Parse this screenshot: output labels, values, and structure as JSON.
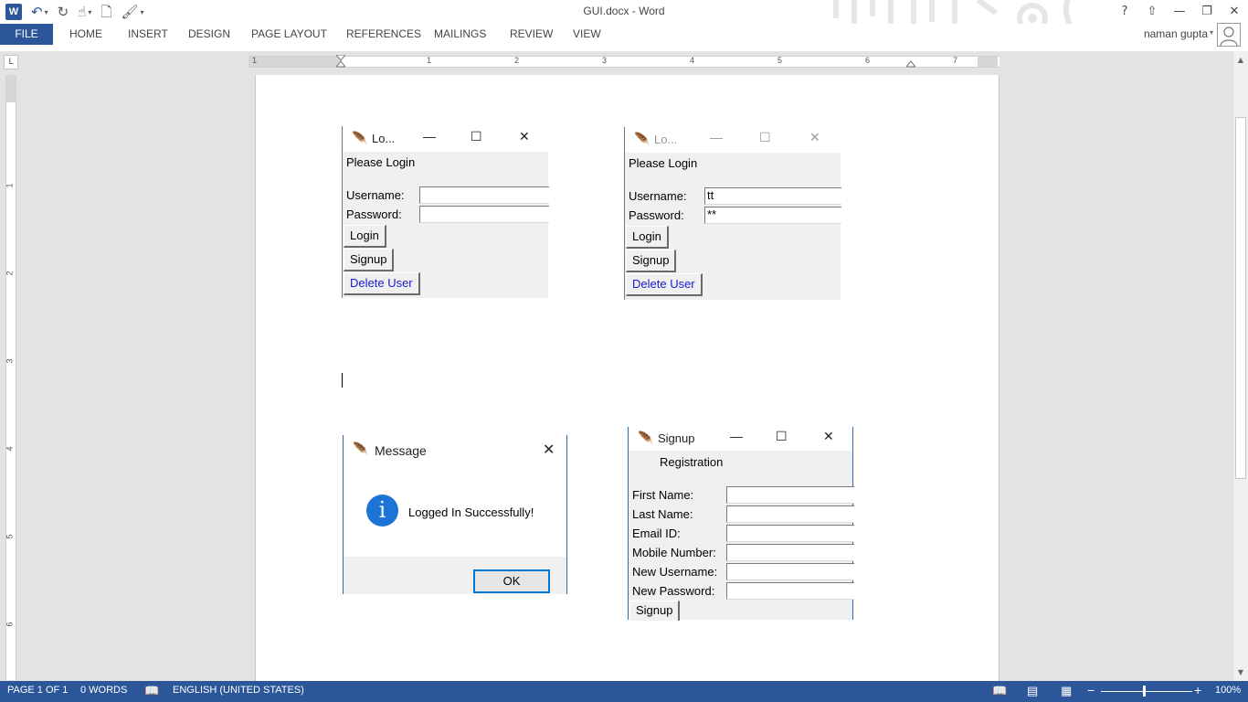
{
  "app": {
    "doc_title": "GUI.docx - Word",
    "user_name": "naman gupta"
  },
  "qat": {
    "logo": "W",
    "icons": [
      "word-logo",
      "undo-icon",
      "redo-icon",
      "touch-mode-icon",
      "new-document-icon",
      "format-painter-icon",
      "customize-icon"
    ]
  },
  "window_controls": [
    "?",
    "⇧",
    "—",
    "❐",
    "✕"
  ],
  "ribbon": {
    "tabs": [
      "FILE",
      "HOME",
      "INSERT",
      "DESIGN",
      "PAGE LAYOUT",
      "REFERENCES",
      "MAILINGS",
      "REVIEW",
      "VIEW"
    ]
  },
  "ruler": {
    "h_numbers": [
      "1",
      "1",
      "2",
      "3",
      "4",
      "5",
      "6",
      "7"
    ],
    "v_numbers": [
      "1",
      "2",
      "3",
      "4",
      "5",
      "6"
    ],
    "corner": "L"
  },
  "login1": {
    "title": "Lo...",
    "heading": "Please Login",
    "username_label": "Username:",
    "password_label": "Password:",
    "username_value": "",
    "password_value": "",
    "login_btn": "Login",
    "signup_btn": "Signup",
    "delete_btn": "Delete User"
  },
  "login2": {
    "title": "Lo...",
    "heading": "Please Login",
    "username_label": "Username:",
    "password_label": "Password:",
    "username_value": "tt",
    "password_value": "**",
    "login_btn": "Login",
    "signup_btn": "Signup",
    "delete_btn": "Delete User"
  },
  "message": {
    "title": "Message",
    "icon": "i",
    "text": "Logged In Successfully!",
    "ok": "OK"
  },
  "signup": {
    "title": "Signup",
    "heading": "Registration",
    "fields": [
      "First Name:",
      "Last Name:",
      "Email ID:",
      "Mobile Number:",
      "New Username:",
      "New Password:"
    ],
    "button": "Signup"
  },
  "status": {
    "page": "PAGE 1 OF 1",
    "words": "0 WORDS",
    "language": "ENGLISH (UNITED STATES)",
    "zoom": "100%",
    "zoom_minus": "−",
    "zoom_plus": "+"
  },
  "colors": {
    "accent": "#2b579a",
    "link_blue": "#1a1ad0",
    "info_blue": "#1e74d6"
  }
}
